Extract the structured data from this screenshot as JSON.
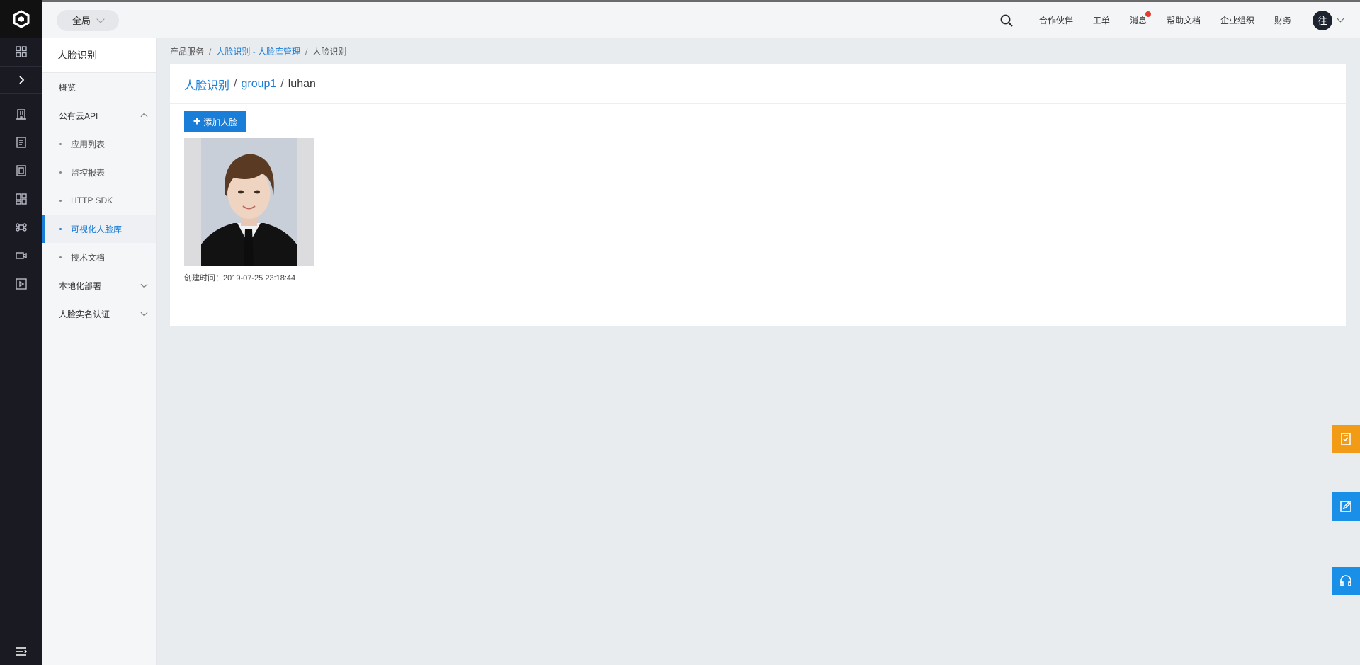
{
  "topbar": {
    "scope_label": "全局",
    "nav": [
      "合作伙伴",
      "工单",
      "消息",
      "帮助文档",
      "企业组织",
      "财务"
    ],
    "avatar_text": "往"
  },
  "sidebar": {
    "title": "人脸识别",
    "items": [
      {
        "label": "概览",
        "type": "item"
      },
      {
        "label": "公有云API",
        "type": "group",
        "expanded": true
      },
      {
        "label": "应用列表",
        "type": "sub"
      },
      {
        "label": "监控报表",
        "type": "sub"
      },
      {
        "label": "HTTP SDK",
        "type": "sub"
      },
      {
        "label": "可视化人脸库",
        "type": "sub",
        "active": true
      },
      {
        "label": "技术文档",
        "type": "sub"
      },
      {
        "label": "本地化部署",
        "type": "group",
        "expanded": false
      },
      {
        "label": "人脸实名认证",
        "type": "group",
        "expanded": false
      }
    ]
  },
  "breadcrumb": {
    "root": "产品服务",
    "parent": "人脸识别 - 人脸库管理",
    "current": "人脸识别"
  },
  "card": {
    "path_root": "人脸识别",
    "path_group": "group1",
    "path_user": "luhan",
    "add_button": "添加人脸",
    "face": {
      "created_label": "创建时间：",
      "created_value": "2019-07-25 23:18:44"
    }
  },
  "colors": {
    "accent": "#1a7ed8",
    "rail": "#1a1a23",
    "float_orange": "#f29b17",
    "float_blue": "#1a8fe8"
  }
}
